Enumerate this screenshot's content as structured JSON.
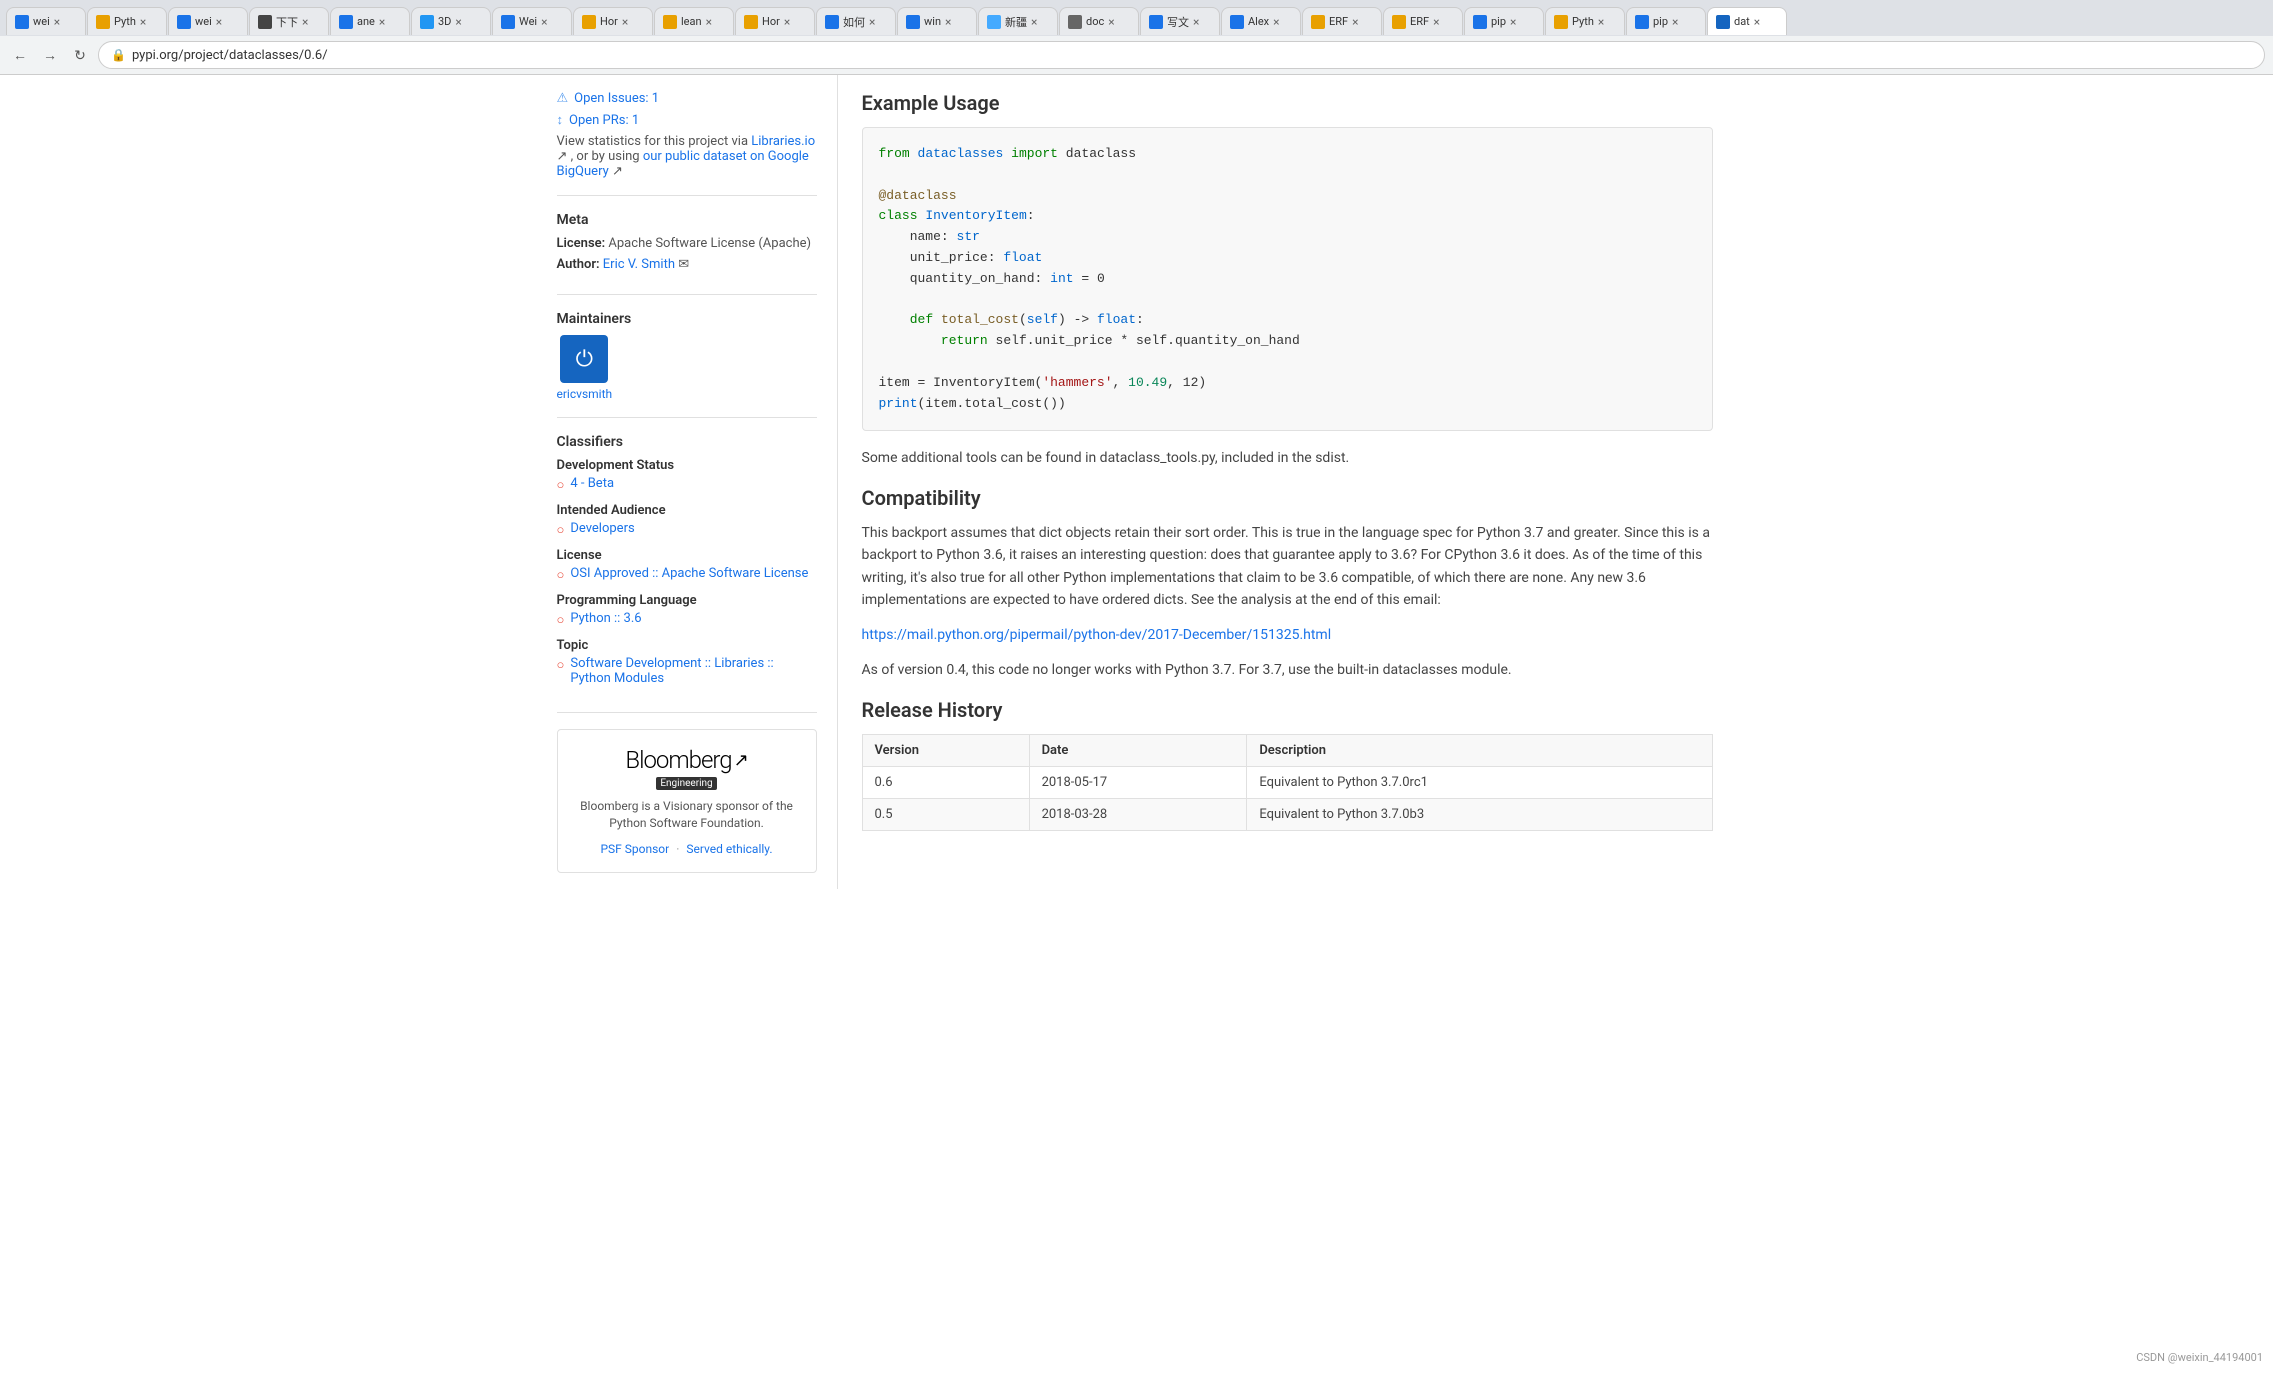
{
  "browser": {
    "address": "pypi.org/project/dataclasses/0.6/",
    "tabs": [
      {
        "label": "wei",
        "favicon_color": "#1a73e8",
        "active": false
      },
      {
        "label": "Pyth",
        "favicon_color": "#e8a000",
        "active": false
      },
      {
        "label": "wei",
        "favicon_color": "#1a73e8",
        "active": false
      },
      {
        "label": "下下",
        "favicon_color": "#444",
        "active": false
      },
      {
        "label": "ane",
        "favicon_color": "#1a73e8",
        "active": false
      },
      {
        "label": "3D",
        "favicon_color": "#2196f3",
        "active": false
      },
      {
        "label": "Wei",
        "favicon_color": "#1a73e8",
        "active": false
      },
      {
        "label": "Hor",
        "favicon_color": "#e8a000",
        "active": false
      },
      {
        "label": "lean",
        "favicon_color": "#e8a000",
        "active": false
      },
      {
        "label": "Hor",
        "favicon_color": "#e8a000",
        "active": false
      },
      {
        "label": "如何",
        "favicon_color": "#1a73e8",
        "active": false
      },
      {
        "label": "win",
        "favicon_color": "#1a73e8",
        "active": false
      },
      {
        "label": "新疆",
        "favicon_color": "#44aaff",
        "active": false
      },
      {
        "label": "doc",
        "favicon_color": "#666",
        "active": false
      },
      {
        "label": "写文",
        "favicon_color": "#1a73e8",
        "active": false
      },
      {
        "label": "Alex",
        "favicon_color": "#1a73e8",
        "active": false
      },
      {
        "label": "ERF",
        "favicon_color": "#e8a000",
        "active": false
      },
      {
        "label": "ERF",
        "favicon_color": "#e8a000",
        "active": false
      },
      {
        "label": "pip",
        "favicon_color": "#1a73e8",
        "active": false
      },
      {
        "label": "Pyth",
        "favicon_color": "#e8a000",
        "active": false
      },
      {
        "label": "pip",
        "favicon_color": "#1a73e8",
        "active": false
      },
      {
        "label": "dat",
        "favicon_color": "#1565c0",
        "active": true
      }
    ]
  },
  "sidebar": {
    "open_issues_label": "Open Issues: 1",
    "open_prs_label": "Open PRs: 1",
    "statistics_text": "View statistics for this project via",
    "libraries_io_label": "Libraries.io",
    "or_text": ", or by using",
    "public_dataset_label": "our public dataset on Google BigQuery",
    "meta_title": "Meta",
    "license_label": "License:",
    "license_value": "Apache Software License (Apache)",
    "author_label": "Author:",
    "author_name": "Eric V. Smith",
    "maintainers_title": "Maintainers",
    "maintainer_name": "ericvsmith",
    "maintainer_icon": "⏻",
    "classifiers_title": "Classifiers",
    "dev_status_title": "Development Status",
    "dev_status_value": "4 - Beta",
    "intended_audience_title": "Intended Audience",
    "intended_audience_value": "Developers",
    "license_classifier_title": "License",
    "license_classifier_value": "OSI Approved :: Apache Software License",
    "programming_language_title": "Programming Language",
    "programming_language_value": "Python :: 3.6",
    "topic_title": "Topic",
    "topic_value": "Software Development :: Libraries :: Python Modules",
    "sponsor_logo": "Bloomberg",
    "sponsor_engineering": "Engineering",
    "sponsor_text": "Bloomberg is a Visionary sponsor of the Python Software Foundation.",
    "psf_sponsor_label": "PSF Sponsor",
    "served_ethically_label": "Served ethically."
  },
  "main": {
    "example_usage_title": "Example Usage",
    "code_lines": [
      "from dataclasses import dataclass",
      "",
      "@dataclass",
      "class InventoryItem:",
      "    name: str",
      "    unit_price: float",
      "    quantity_on_hand: int = 0",
      "",
      "    def total_cost(self) -> float:",
      "        return self.unit_price * self.quantity_on_hand",
      "",
      "item = InventoryItem('hammers', 10.49, 12)",
      "print(item.total_cost())"
    ],
    "additional_tools_text": "Some additional tools can be found in dataclass_tools.py, included in the sdist.",
    "compatibility_title": "Compatibility",
    "compatibility_text": "This backport assumes that dict objects retain their sort order. This is true in the language spec for Python 3.7 and greater. Since this is a backport to Python 3.6, it raises an interesting question: does that guarantee apply to 3.6? For CPython 3.6 it does. As of the time of this writing, it's also true for all other Python implementations that claim to be 3.6 compatible, of which there are none. Any new 3.6 implementations are expected to have ordered dicts. See the analysis at the end of this email:",
    "compat_link": "https://mail.python.org/pipermail/python-dev/2017-December/151325.html",
    "version_note": "As of version 0.4, this code no longer works with Python 3.7. For 3.7, use the built-in dataclasses module.",
    "release_history_title": "Release History",
    "table_headers": [
      "Version",
      "Date",
      "Description"
    ],
    "table_rows": [
      {
        "version": "0.6",
        "date": "2018-05-17",
        "description": "Equivalent to Python 3.7.0rc1"
      },
      {
        "version": "0.5",
        "date": "2018-03-28",
        "description": "Equivalent to Python 3.7.0b3"
      }
    ]
  },
  "watermark": "CSDN @weixin_44194001"
}
